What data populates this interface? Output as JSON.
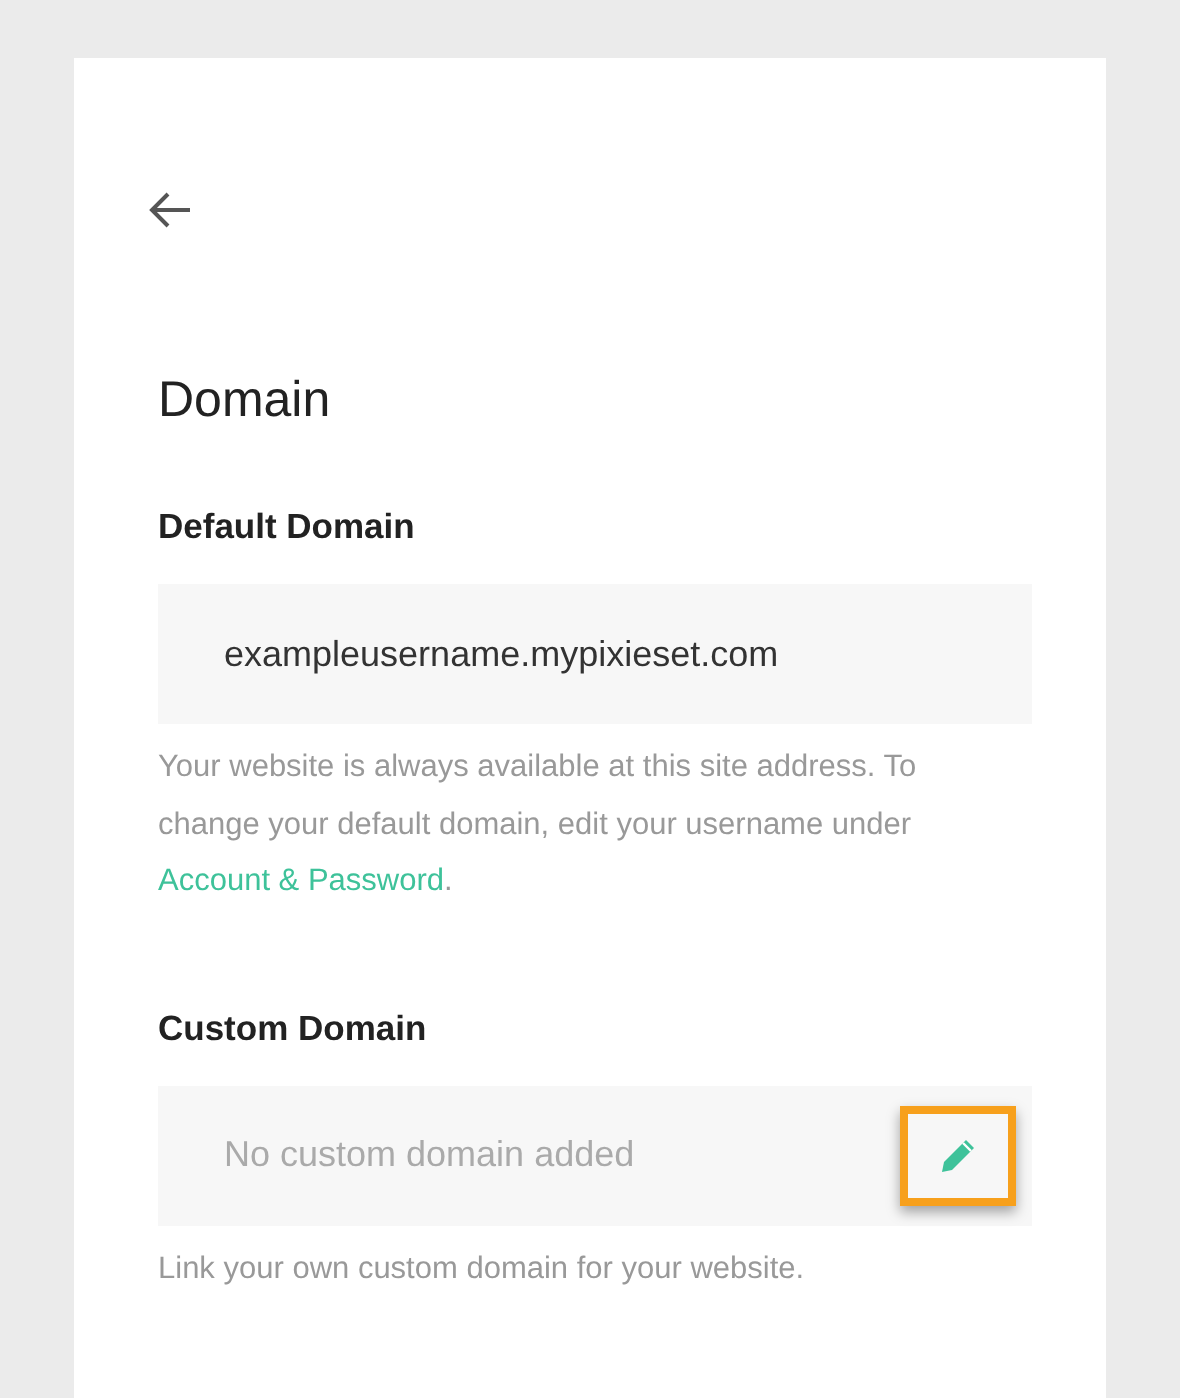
{
  "title": "Domain",
  "sections": [
    {
      "label": "Default Domain",
      "field": {
        "value": "exampleusername.mypixieset.com"
      },
      "help": {
        "text": "Your website is always available at this site address. To change your default domain, edit your username under ",
        "link": "Account & Password",
        "after": "."
      }
    },
    {
      "label": "Custom Domain",
      "field": {
        "placeholder": "No custom domain added",
        "edit_button": {
          "highlighted": true
        }
      },
      "help": {
        "text": "Link your own custom domain for your website."
      }
    }
  ]
}
